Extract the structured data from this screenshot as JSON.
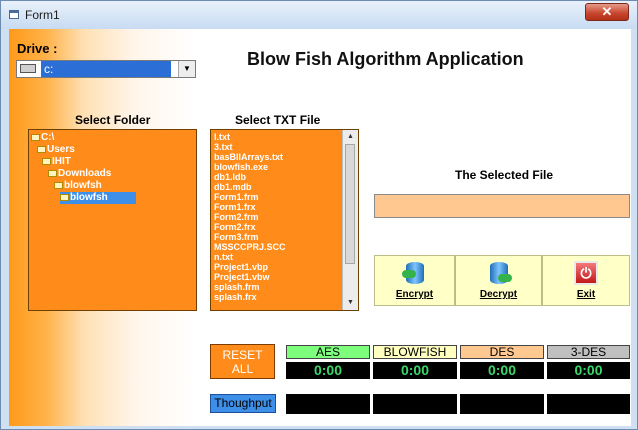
{
  "window": {
    "title": "Form1",
    "close_glyph": "✕"
  },
  "drive": {
    "label": "Drive :",
    "value": "c:",
    "icon": "drive-icon"
  },
  "app_title": "Blow Fish Algorithm Application",
  "folder": {
    "label": "Select Folder",
    "items": [
      {
        "name": "C:\\",
        "selected": false
      },
      {
        "name": "Users",
        "selected": false
      },
      {
        "name": "IHIT",
        "selected": false
      },
      {
        "name": "Downloads",
        "selected": false
      },
      {
        "name": "blowfsh",
        "selected": false
      },
      {
        "name": "blowfsh",
        "selected": true
      }
    ]
  },
  "files": {
    "label": "Select TXT File",
    "items": [
      "l.txt",
      "3.txt",
      "basBlIArrays.txt",
      "blowfish.exe",
      "db1.ldb",
      "db1.mdb",
      "Form1.frm",
      "Form1.frx",
      "Form2.frm",
      "Form2.frx",
      "Form3.frm",
      "MSSCCPRJ.SCC",
      "n.txt",
      "Project1.vbp",
      "Project1.vbw",
      "splash.frm",
      "splash.frx"
    ]
  },
  "selected_file": {
    "label": "The Selected File",
    "value": ""
  },
  "buttons": {
    "encrypt": {
      "label": "Encrypt"
    },
    "decrypt": {
      "label": "Decrypt"
    },
    "exit": {
      "label": "Exit"
    }
  },
  "reset": {
    "label_line1": "RESET",
    "label_line2": "ALL"
  },
  "algorithms": [
    {
      "name": "AES",
      "value": "0:00",
      "color": "#7dff7d"
    },
    {
      "name": "BLOWFISH",
      "value": "0:00",
      "color": "#ffffc0"
    },
    {
      "name": "DES",
      "value": "0:00",
      "color": "#ffc891"
    },
    {
      "name": "3-DES",
      "value": "0:00",
      "color": "#c0c0c0"
    }
  ],
  "throughput": {
    "label": "Thoughput"
  }
}
